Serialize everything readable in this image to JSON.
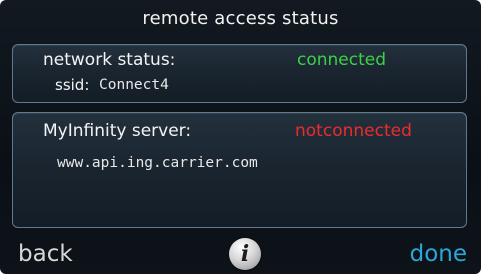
{
  "header": {
    "title": "remote access status"
  },
  "network": {
    "label": "network status:",
    "status": "connected",
    "ssid_label": "ssid:",
    "ssid_value": "Connect4"
  },
  "server": {
    "label": "MyInfinity server:",
    "status": "notconnected",
    "address": "www.api.ing.carrier.com"
  },
  "footer": {
    "back_label": "back",
    "info_glyph": "i",
    "done_label": "done"
  },
  "colors": {
    "connected": "#3ecf4a",
    "not_connected": "#ee2b2b",
    "done": "#2ba7d8"
  },
  "icons": {
    "info": "info-icon"
  }
}
